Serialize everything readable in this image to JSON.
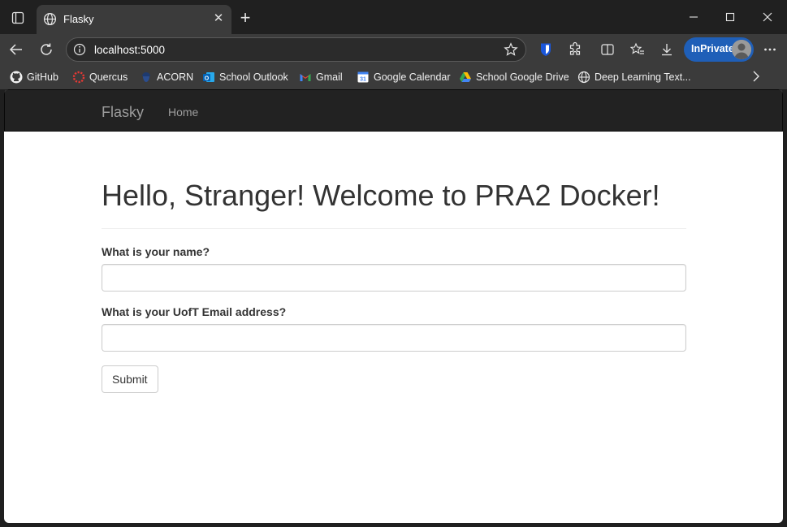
{
  "browser": {
    "tab": {
      "title": "Flasky"
    },
    "address": {
      "url": "localhost:5000"
    },
    "profile": {
      "label": "InPrivate"
    },
    "bookmarks": [
      {
        "label": "GitHub",
        "icon": "github-icon"
      },
      {
        "label": "Quercus",
        "icon": "quercus-icon"
      },
      {
        "label": "ACORN",
        "icon": "acorn-icon"
      },
      {
        "label": "School Outlook",
        "icon": "outlook-icon"
      },
      {
        "label": "Gmail",
        "icon": "gmail-icon"
      },
      {
        "label": "Google Calendar",
        "icon": "google-calendar-icon"
      },
      {
        "label": "School Google Drive",
        "icon": "google-drive-icon"
      },
      {
        "label": "Deep Learning Text...",
        "icon": "globe-icon"
      }
    ],
    "colors": {
      "chrome": "#3b3b3b",
      "titlebar": "#202020",
      "inprivate": "#1f5fb8"
    }
  },
  "page": {
    "navbar": {
      "brand": "Flasky",
      "home": "Home"
    },
    "title": "Hello, Stranger! Welcome to PRA2 Docker!",
    "form": {
      "name_label": "What is your name?",
      "name_value": "",
      "email_label": "What is your UofT Email address?",
      "email_value": "",
      "submit_label": "Submit"
    },
    "colors": {
      "navbar_bg": "#222222",
      "nav_text": "#9d9d9d",
      "text": "#333333"
    }
  }
}
